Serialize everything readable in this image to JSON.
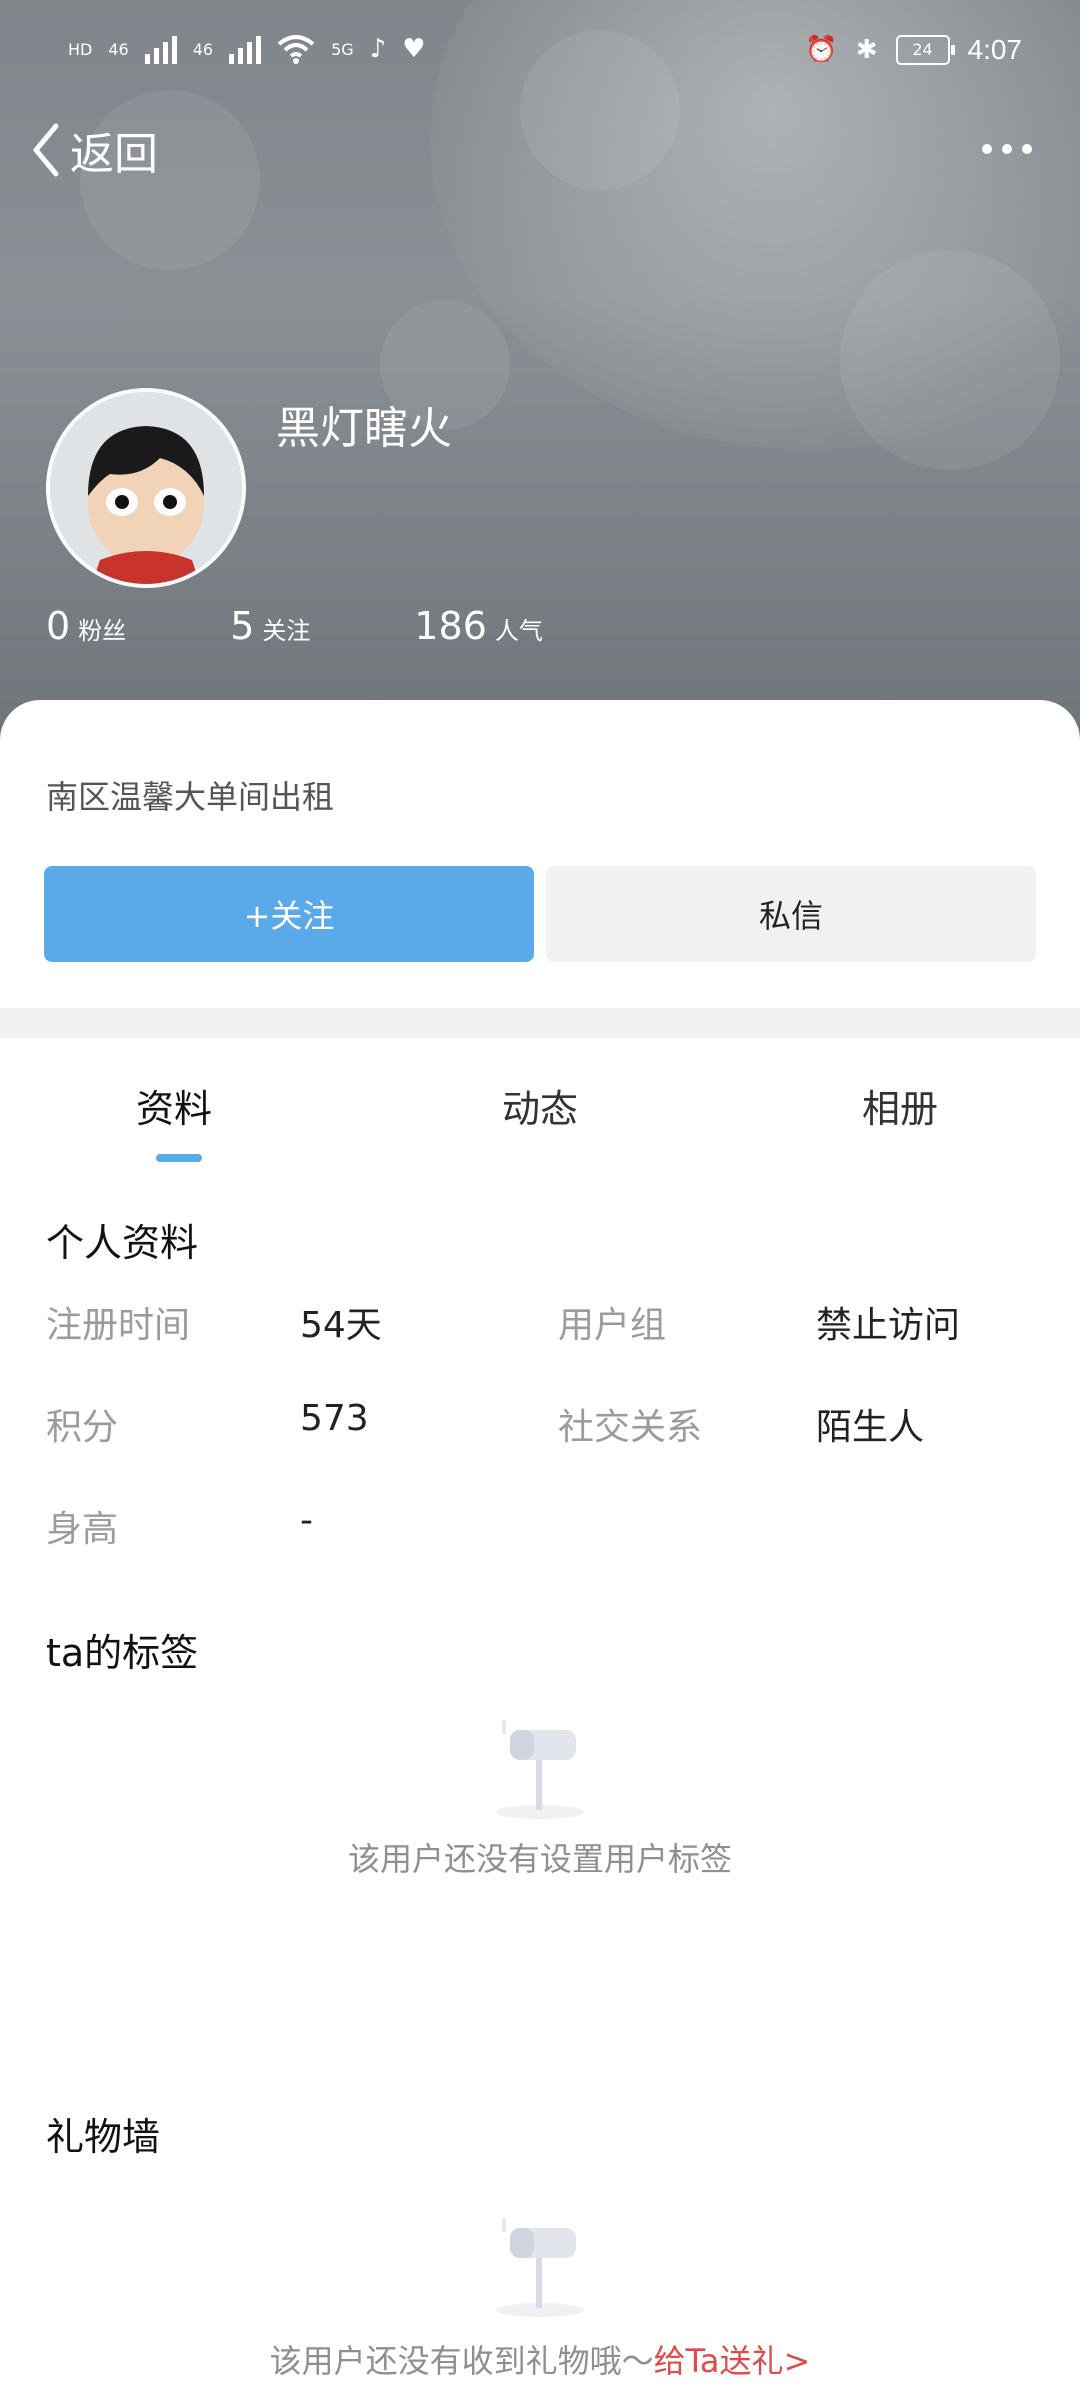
{
  "status_bar": {
    "left_indicators": [
      "HD",
      "46",
      "46",
      "5G"
    ],
    "time": "4:07",
    "battery": "24"
  },
  "header": {
    "back_label": "返回",
    "more_icon": "more-dots-icon"
  },
  "profile": {
    "nickname": "黑灯瞎火",
    "stats": [
      {
        "value": "0",
        "label": "粉丝"
      },
      {
        "value": "5",
        "label": "关注"
      },
      {
        "value": "186",
        "label": "人气"
      }
    ],
    "bio": "南区温馨大单间出租"
  },
  "actions": {
    "follow_label": "+关注",
    "message_label": "私信"
  },
  "tabs": [
    "资料",
    "动态",
    "相册"
  ],
  "details": {
    "title": "个人资料",
    "rows": [
      {
        "k1": "注册时间",
        "v1": "54天",
        "k2": "用户组",
        "v2": "禁止访问"
      },
      {
        "k1": "积分",
        "v1": "573",
        "k2": "社交关系",
        "v2": "陌生人"
      },
      {
        "k1": "身高",
        "v1": "-",
        "k2": "",
        "v2": ""
      }
    ]
  },
  "tags": {
    "title": "ta的标签",
    "empty_text": "该用户还没有设置用户标签"
  },
  "gifts": {
    "title": "礼物墙",
    "empty_text": "该用户还没有收到礼物哦～",
    "send_gift_label": "给Ta送礼>"
  },
  "colors": {
    "accent": "#5aaaea",
    "link_red": "#e24a4a"
  }
}
